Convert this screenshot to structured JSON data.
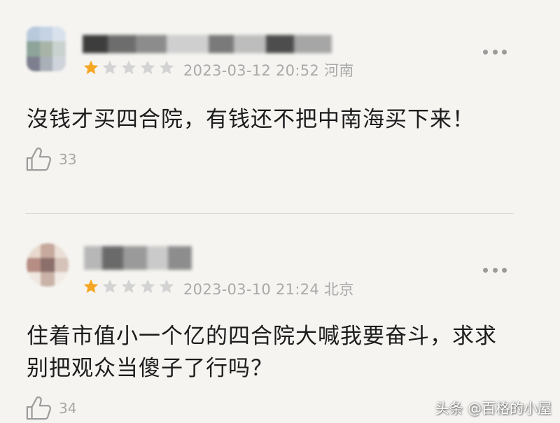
{
  "colors": {
    "background": "#f5f4f1",
    "star_filled": "#f5a623",
    "star_empty": "#d3d3d3",
    "meta_text": "#a9a9a9",
    "body_text": "#1c1c1c"
  },
  "comments": [
    {
      "rating": 1,
      "max_rating": 5,
      "date_time": "2023-03-12 20:52",
      "location": "河南",
      "text": "沒钱才买四合院，有钱还不把中南海买下来！",
      "likes": "33"
    },
    {
      "rating": 1,
      "max_rating": 5,
      "date_time": "2023-03-10 21:24",
      "location": "北京",
      "text": "住着市值小一个亿的四合院大喊我要奋斗，求求别把观众当傻子了行吗？",
      "likes": "34"
    }
  ],
  "icons": {
    "more": "more-dots-icon",
    "like": "thumbs-up-icon",
    "star": "star-icon"
  },
  "watermark": "头条 @百格的小屋"
}
